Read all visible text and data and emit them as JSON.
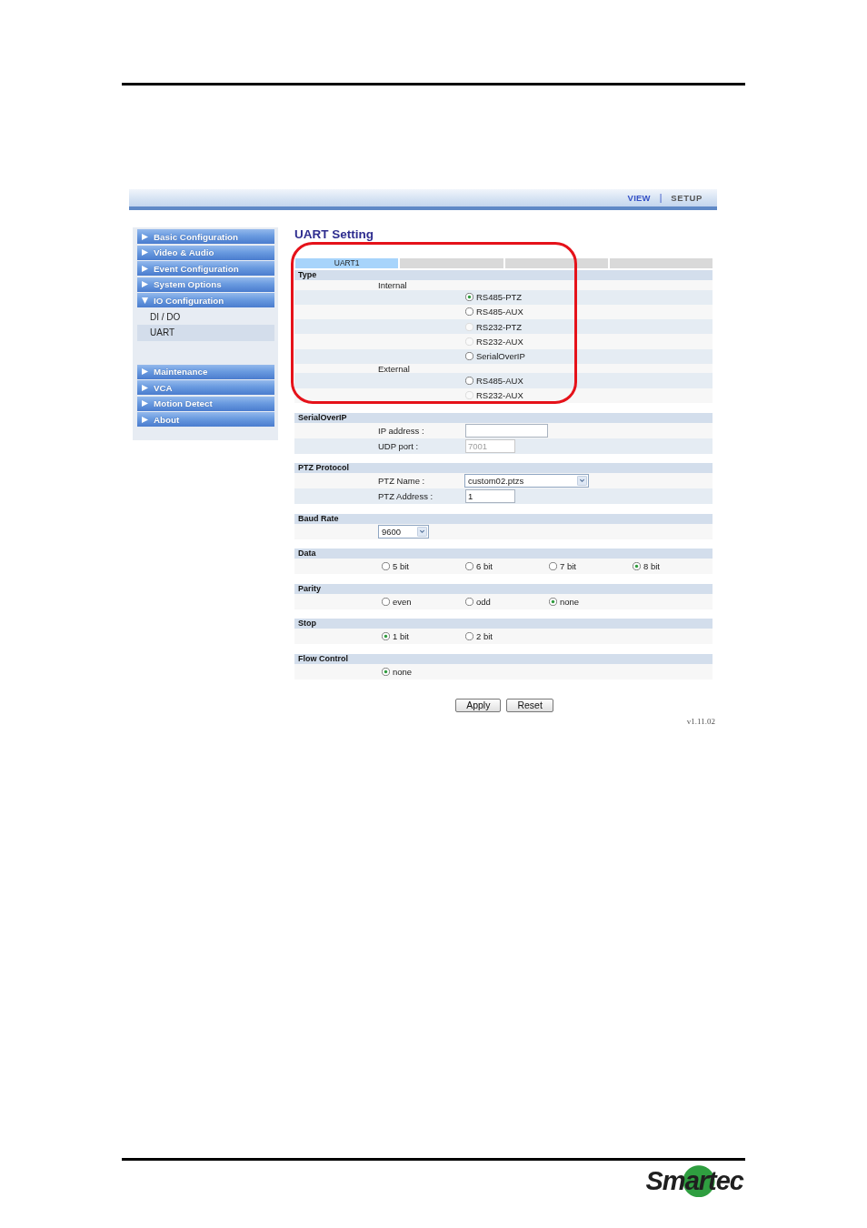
{
  "top_nav": {
    "links": [
      {
        "label": "VIEW",
        "selected": false
      },
      {
        "label": "SETUP",
        "selected": true
      }
    ],
    "separator": "|"
  },
  "sidebar": {
    "items": [
      {
        "label": "Basic Configuration",
        "expanded": false
      },
      {
        "label": "Video & Audio",
        "expanded": false
      },
      {
        "label": "Event Configuration",
        "expanded": false
      },
      {
        "label": "System Options",
        "expanded": false
      },
      {
        "label": "IO Configuration",
        "expanded": true,
        "children": [
          {
            "label": "DI / DO",
            "selected": false
          },
          {
            "label": "UART",
            "selected": true
          }
        ]
      },
      {
        "label": "Maintenance",
        "expanded": false
      },
      {
        "label": "VCA",
        "expanded": false
      },
      {
        "label": "Motion Detect",
        "expanded": false
      },
      {
        "label": "About",
        "expanded": false
      }
    ]
  },
  "title": "UART Setting",
  "tabs": [
    {
      "label": "UART1",
      "selected": true
    },
    {
      "selected": false
    },
    {
      "selected": false
    },
    {
      "selected": false
    }
  ],
  "sections": [
    {
      "heading": "Type",
      "highlighted": true,
      "rows": [
        {
          "kind": "group",
          "label": "Internal"
        },
        {
          "kind": "radio",
          "label": "RS485-PTZ",
          "selected": true,
          "disabled": false
        },
        {
          "kind": "radio",
          "label": "RS485-AUX",
          "selected": false,
          "disabled": false
        },
        {
          "kind": "radio",
          "label": "RS232-PTZ",
          "selected": false,
          "disabled": true
        },
        {
          "kind": "radio",
          "label": "RS232-AUX",
          "selected": false,
          "disabled": true
        },
        {
          "kind": "radio",
          "label": "SerialOverIP",
          "selected": false,
          "disabled": false
        },
        {
          "kind": "group",
          "label": "External"
        },
        {
          "kind": "radio",
          "label": "RS485-AUX",
          "selected": false,
          "disabled": false
        },
        {
          "kind": "radio",
          "label": "RS232-AUX",
          "selected": false,
          "disabled": true
        }
      ]
    },
    {
      "heading": "SerialOverIP",
      "highlighted": false,
      "rows": [
        {
          "kind": "ip",
          "label": "IP address :",
          "disabled": false
        },
        {
          "kind": "input",
          "label": "UDP port :",
          "value": "7001",
          "disabled": true
        }
      ]
    },
    {
      "heading": "PTZ Protocol",
      "highlighted": false,
      "rows": [
        {
          "kind": "select",
          "label": "PTZ Name :",
          "value": "custom02.ptzs"
        },
        {
          "kind": "input",
          "label": "PTZ Address :",
          "value": "1",
          "disabled": false
        }
      ]
    },
    {
      "heading": "Baud Rate",
      "highlighted": false,
      "rows": [
        {
          "kind": "select",
          "value": "9600"
        }
      ]
    },
    {
      "heading": "Data",
      "highlighted": false,
      "rows": [
        {
          "kind": "options",
          "options": [
            {
              "label": "5 bit",
              "selected": false
            },
            {
              "label": "6 bit",
              "selected": false
            },
            {
              "label": "7 bit",
              "selected": false
            },
            {
              "label": "8 bit",
              "selected": true
            }
          ]
        }
      ]
    },
    {
      "heading": "Parity",
      "highlighted": false,
      "rows": [
        {
          "kind": "options",
          "options": [
            {
              "label": "even",
              "selected": false
            },
            {
              "label": "odd",
              "selected": false
            },
            {
              "label": "none",
              "selected": true
            }
          ]
        }
      ]
    },
    {
      "heading": "Stop",
      "highlighted": false,
      "rows": [
        {
          "kind": "options",
          "options": [
            {
              "label": "1 bit",
              "selected": true
            },
            {
              "label": "2 bit",
              "selected": false
            }
          ]
        }
      ]
    },
    {
      "heading": "Flow Control",
      "highlighted": false,
      "rows": [
        {
          "kind": "options",
          "options": [
            {
              "label": "none",
              "selected": true
            }
          ]
        }
      ]
    }
  ],
  "buttons": [
    "Apply",
    "Reset"
  ],
  "version": "v1.11.02",
  "footer": {
    "logo": "Smartec"
  }
}
